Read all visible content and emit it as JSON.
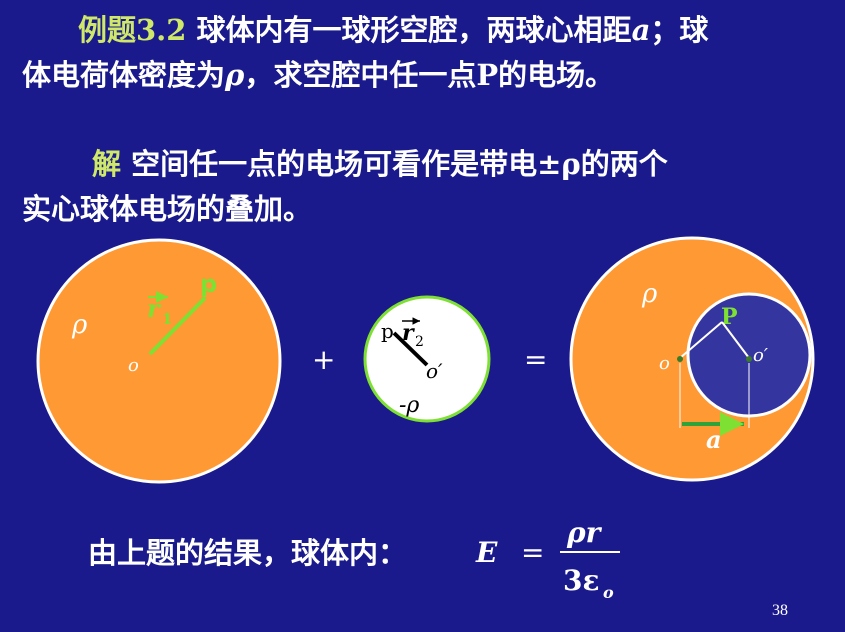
{
  "problem": {
    "title": "例题3.2",
    "line1_text": " 球体内有一球形空腔，两球心相距",
    "var_a": "a",
    "line1_end": "；球",
    "line2_start": "体电荷体密度为",
    "var_rho": "ρ",
    "line2_end": "，求空腔中任一点P的电场。"
  },
  "solution": {
    "label": "解",
    "line1": "  空间任一点的电场可看作是带电±ρ的两个",
    "line2": "实心球体电场的叠加。"
  },
  "figure": {
    "left": {
      "rho": "ρ",
      "point": "p",
      "vector": "r",
      "subscript": "1",
      "origin": "o"
    },
    "middle": {
      "plus": "+",
      "point": "p",
      "vector": "r",
      "subscript": "2",
      "origin": "o′",
      "rho": "-ρ"
    },
    "right": {
      "equals": "=",
      "rho": "ρ",
      "point": "P",
      "origin1": "o",
      "origin2": "o′",
      "distance": "a"
    }
  },
  "result": {
    "lead": "由上题的结果，球体内：",
    "E": "E",
    "eq": "=",
    "numerator": "ρr",
    "denominator": "3ε",
    "denom_sub": "o"
  },
  "page_number": "38",
  "colors": {
    "background": "#1a1a8c",
    "orange": "#ff9933",
    "green": "#7ee032",
    "dark_blue": "#3535a0",
    "highlight": "#cfe86a"
  }
}
